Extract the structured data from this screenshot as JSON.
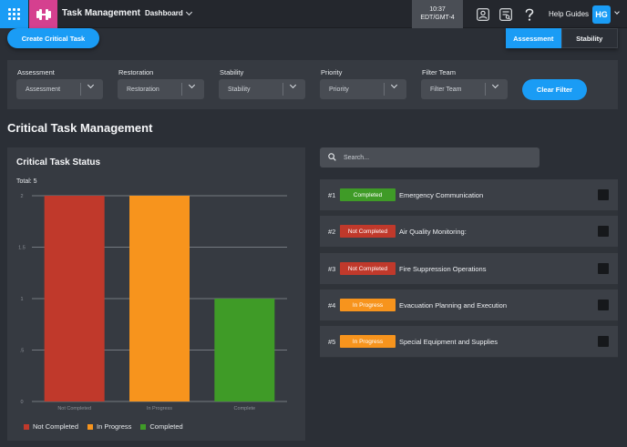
{
  "header": {
    "app_title": "Task Management",
    "dashboard_label": "Dashboard",
    "time": "10:37",
    "timezone": "EDT/GMT-4",
    "help_label": "Help Guides",
    "avatar_initials": "HG",
    "icons": [
      "apps-grid-icon",
      "dumbbell-icon",
      "user-icon",
      "report-icon",
      "help-icon",
      "chevron-down-icon"
    ]
  },
  "actions": {
    "create_label": "Create Critical Task",
    "seg_assessment": "Assessment",
    "seg_stability": "Stability",
    "active_segment": "Assessment"
  },
  "filters": {
    "items": [
      {
        "label": "Assessment",
        "value": "Assessment"
      },
      {
        "label": "Restoration",
        "value": "Restoration"
      },
      {
        "label": "Stability",
        "value": "Stability"
      },
      {
        "label": "Priority",
        "value": "Priority"
      },
      {
        "label": "Filter Team",
        "value": "Filter Team"
      }
    ],
    "clear_label": "Clear Filter"
  },
  "page_title": "Critical Task Management",
  "chart": {
    "title": "Critical Task Status",
    "total_label": "Total: 5"
  },
  "chart_data": {
    "type": "bar",
    "categories": [
      "Not Completed",
      "In Progress",
      "Complete"
    ],
    "values": [
      2,
      2,
      1
    ],
    "colors": [
      "#c0392b",
      "#f7941d",
      "#3f9b27"
    ],
    "ylim": [
      0,
      2
    ],
    "yticks": [
      "0",
      ".5",
      "1",
      "1.5",
      "2"
    ],
    "grid": true,
    "legend": [
      "Not Completed",
      "In Progress",
      "Completed"
    ],
    "legend_position": "bottom-left"
  },
  "search": {
    "placeholder": "Search..."
  },
  "tasks": [
    {
      "num": "#1",
      "status": "Completed",
      "status_color": "#3f9b27",
      "name": "Emergency Communication"
    },
    {
      "num": "#2",
      "status": "Not Completed",
      "status_color": "#c0392b",
      "name": "Air Quality Monitoring:"
    },
    {
      "num": "#3",
      "status": "Not Completed",
      "status_color": "#c0392b",
      "name": "Fire Suppression Operations"
    },
    {
      "num": "#4",
      "status": "In Progress",
      "status_color": "#f7941d",
      "name": "Evacuation Planning and Execution"
    },
    {
      "num": "#5",
      "status": "In Progress",
      "status_color": "#f7941d",
      "name": "Special Equipment and Supplies"
    }
  ],
  "colors": {
    "accent": "#1a9cf5",
    "brand_pink": "#d5408f"
  }
}
